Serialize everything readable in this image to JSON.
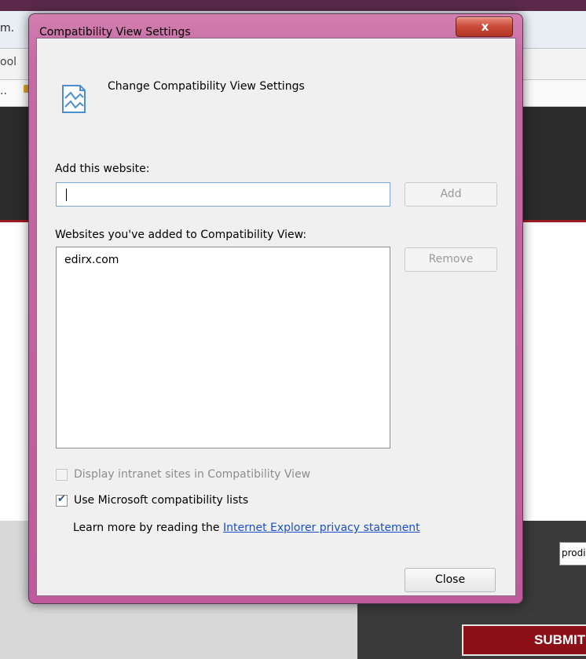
{
  "background": {
    "address_fragment": "m.",
    "menu_fragment": "ool",
    "favorites_fragment": "..",
    "email_fragment": "prodigoso",
    "submit_label": "SUBMIT"
  },
  "dialog": {
    "title": "Compatibility View Settings",
    "close_glyph": "x",
    "header": "Change Compatibility View Settings",
    "add_label": "Add this website:",
    "add_input_value": "",
    "add_button": "Add",
    "list_label": "Websites you've added to Compatibility View:",
    "sites": [
      "edirx.com"
    ],
    "remove_button": "Remove",
    "intranet_option": {
      "label": "Display intranet sites in Compatibility View",
      "checked": false,
      "enabled": false
    },
    "ms_lists_option": {
      "label": "Use Microsoft compatibility lists",
      "checked": true,
      "enabled": true
    },
    "learn_more_prefix": "Learn more by reading the",
    "privacy_link": "Internet Explorer privacy statement",
    "close_button": "Close"
  },
  "colors": {
    "title_frame": "#c15a9c",
    "close_x": "#c94a3a",
    "link": "#1a4fc8",
    "submit_bg": "#8c1016"
  }
}
